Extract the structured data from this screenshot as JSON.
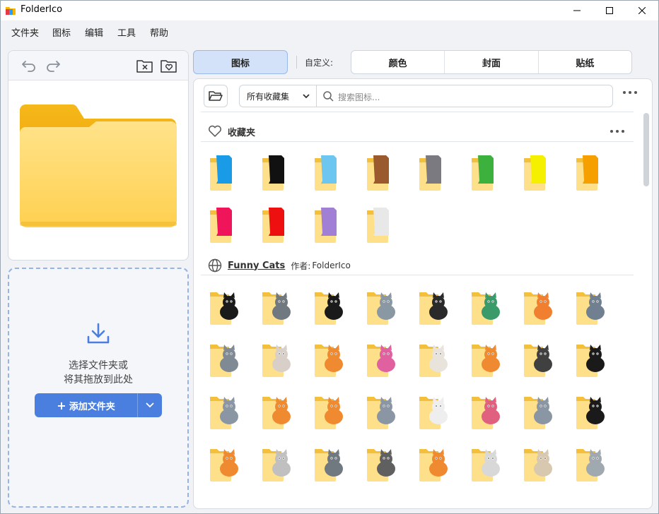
{
  "window": {
    "title": "FolderIco"
  },
  "menu": [
    "文件夹",
    "图标",
    "编辑",
    "工具",
    "帮助"
  ],
  "dropzone": {
    "line1": "选择文件夹或",
    "line2": "将其拖放到此处",
    "add_button": "添加文件夹"
  },
  "tabs": {
    "icons": "图标",
    "custom_label": "自定义:",
    "segments": [
      "颜色",
      "封面",
      "贴纸"
    ]
  },
  "search": {
    "collection": "所有收藏集",
    "placeholder": "搜索图标..."
  },
  "favorites": {
    "title": "收藏夹",
    "colors": [
      "#1a9be8",
      "#111111",
      "#6cc6f0",
      "#9a5a2e",
      "#7a7a80",
      "#3db13d",
      "#f5f000",
      "#f5a000",
      "#f0145a",
      "#ee1010",
      "#a07fd4",
      "#e8e8e8"
    ]
  },
  "collection": {
    "name": "Funny Cats",
    "author_prefix": "作者:",
    "author": "FolderIco",
    "cat_colors": [
      "#1a1a1a",
      "#707880",
      "#1a1a1a",
      "#8a98a4",
      "#2a2a2a",
      "#3a9a6a",
      "#f08030",
      "#708090",
      "#808a94",
      "#d8d0c8",
      "#f08a30",
      "#e060a0",
      "#e8e4dc",
      "#f08a30",
      "#404040",
      "#1a1a1a",
      "#8a96a4",
      "#f08a30",
      "#f08a30",
      "#8a96a4",
      "#eeeeee",
      "#e06080",
      "#8a96a4",
      "#1a1a1a",
      "#f08a30",
      "#c0c0c0",
      "#707880",
      "#606060",
      "#f08a30",
      "#d8d8d8",
      "#d8c8b0",
      "#a0a8b0"
    ]
  }
}
